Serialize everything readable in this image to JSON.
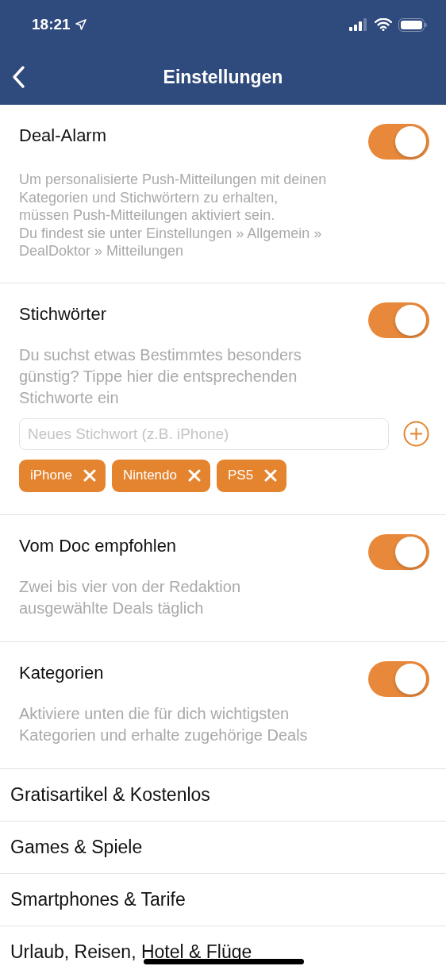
{
  "status_bar": {
    "time": "18:21"
  },
  "nav": {
    "title": "Einstellungen"
  },
  "sections": [
    {
      "kind": "toggle",
      "title": "Deal-Alarm",
      "on": true,
      "description": "Um personalisierte Push-Mitteilungen mit deinen\nKategorien und Stichwörtern zu erhalten,\nmüssen Push-Mitteilungen aktiviert sein.\nDu findest sie unter Einstellungen » Allgemein »\nDealDoktor » Mitteilungen"
    },
    {
      "kind": "keywords",
      "title": "Stichwörter",
      "on": true,
      "description": "Du suchst etwas Bestimmtes besonders\ngünstig? Tippe hier die entsprechenden\nStichworte ein",
      "placeholder": "Neues Stichwort (z.B. iPhone)",
      "tags": [
        "iPhone",
        "Nintendo",
        "PS5"
      ]
    },
    {
      "kind": "toggle",
      "title": "Vom Doc empfohlen",
      "on": true,
      "description": "Zwei bis vier von der Redaktion\nausgewählte Deals täglich"
    },
    {
      "kind": "toggle",
      "title": "Kategorien",
      "on": true,
      "description": "Aktiviere unten die für dich wichtigsten\nKategorien und erhalte zugehörige Deals"
    }
  ],
  "categories": [
    "Gratisartikel & Kostenlos",
    "Games & Spiele",
    "Smartphones & Tarife",
    "Urlaub, Reisen, Hotel & Flüge"
  ]
}
